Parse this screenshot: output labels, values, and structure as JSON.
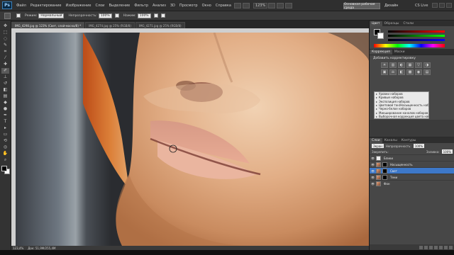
{
  "app": {
    "logo": "Ps"
  },
  "menubar": {
    "items": [
      "Файл",
      "Редактирование",
      "Изображение",
      "Слои",
      "Выделение",
      "Фильтр",
      "Анализ",
      "3D",
      "Просмотр",
      "Окно",
      "Справка"
    ],
    "zoom": "123%",
    "workspace_button": "Основная рабочая среда",
    "design_label": "Дизайн",
    "cslive": "CS Live"
  },
  "options": {
    "mode_label": "Режим:",
    "mode_value": "Нормальный",
    "opacity_label": "Непрозрачность:",
    "opacity_value": "100%",
    "flow_label": "Нажим:",
    "flow_value": "100%"
  },
  "tools": {
    "items": [
      {
        "name": "move-tool-icon",
        "glyph": "✥"
      },
      {
        "name": "marquee-tool-icon",
        "glyph": "⬚"
      },
      {
        "name": "lasso-tool-icon",
        "glyph": "◌"
      },
      {
        "name": "quick-select-tool-icon",
        "glyph": "✎"
      },
      {
        "name": "crop-tool-icon",
        "glyph": "⌗"
      },
      {
        "name": "eyedropper-tool-icon",
        "glyph": "⁄"
      },
      {
        "name": "healing-brush-tool-icon",
        "glyph": "✚"
      },
      {
        "name": "brush-tool-icon",
        "glyph": "✐"
      },
      {
        "name": "clone-stamp-tool-icon",
        "glyph": "⊥"
      },
      {
        "name": "history-brush-tool-icon",
        "glyph": "↺"
      },
      {
        "name": "eraser-tool-icon",
        "glyph": "◧"
      },
      {
        "name": "gradient-tool-icon",
        "glyph": "▤"
      },
      {
        "name": "blur-tool-icon",
        "glyph": "◆"
      },
      {
        "name": "dodge-tool-icon",
        "glyph": "●"
      },
      {
        "name": "pen-tool-icon",
        "glyph": "✒"
      },
      {
        "name": "type-tool-icon",
        "glyph": "T"
      },
      {
        "name": "path-select-tool-icon",
        "glyph": "▸"
      },
      {
        "name": "shape-tool-icon",
        "glyph": "▭"
      },
      {
        "name": "3d-rotate-tool-icon",
        "glyph": "⟲"
      },
      {
        "name": "3d-camera-tool-icon",
        "glyph": "◎"
      },
      {
        "name": "hand-tool-icon",
        "glyph": "✋"
      },
      {
        "name": "zoom-tool-icon",
        "glyph": "⌕"
      }
    ]
  },
  "doc_tabs": [
    {
      "label": "IMG_4298.jpg @ 123% (Свет, слой-маска/8) *",
      "active": true
    },
    {
      "label": "IMG_4274.jpg @ 25% (RGB/8)",
      "active": false
    },
    {
      "label": "IMG_4271.jpg @ 25% (RGB/8)",
      "active": false
    }
  ],
  "status": {
    "zoom": "123,4%",
    "doc": "Док: 51,9M/255,4M"
  },
  "panels": {
    "color_tabs": [
      "Цвет",
      "Образцы",
      "Стили"
    ],
    "adjustment_tabs": [
      "Коррекция",
      "Маски"
    ],
    "adjustment_title": "Добавить корректировку",
    "adjustment_icons": [
      "☀",
      "▥",
      "◐",
      "▦",
      "▽",
      "◑",
      "▣",
      "⚖",
      "◧",
      "▩",
      "◉",
      "▤"
    ],
    "presets": [
      "Уровни наборов",
      "Кривые наборов",
      "Экспозиция наборов",
      "Цветовой тон/Насыщенность наборов",
      "Черно-белое наборов",
      "Микширование каналов наборов",
      "Выборочная коррекция цвета наборов"
    ],
    "layers_tabs": [
      "Слои",
      "Каналы",
      "Контуры"
    ],
    "blend_mode": "Экран",
    "opacity_label": "Непрозрачность:",
    "opacity_value": "100%",
    "lock_label": "Закрепить:",
    "fill_label": "Заливка:",
    "fill_value": "100%",
    "layers": [
      {
        "name": "Блики",
        "thumb": "white",
        "mask": false,
        "selected": false
      },
      {
        "name": "Насыщенность",
        "thumb": "face",
        "mask": true,
        "selected": false
      },
      {
        "name": "Свет",
        "thumb": "face",
        "mask": true,
        "selected": true
      },
      {
        "name": "Тени",
        "thumb": "face",
        "mask": true,
        "selected": false
      },
      {
        "name": "Фон",
        "thumb": "face",
        "mask": false,
        "selected": false
      }
    ]
  }
}
